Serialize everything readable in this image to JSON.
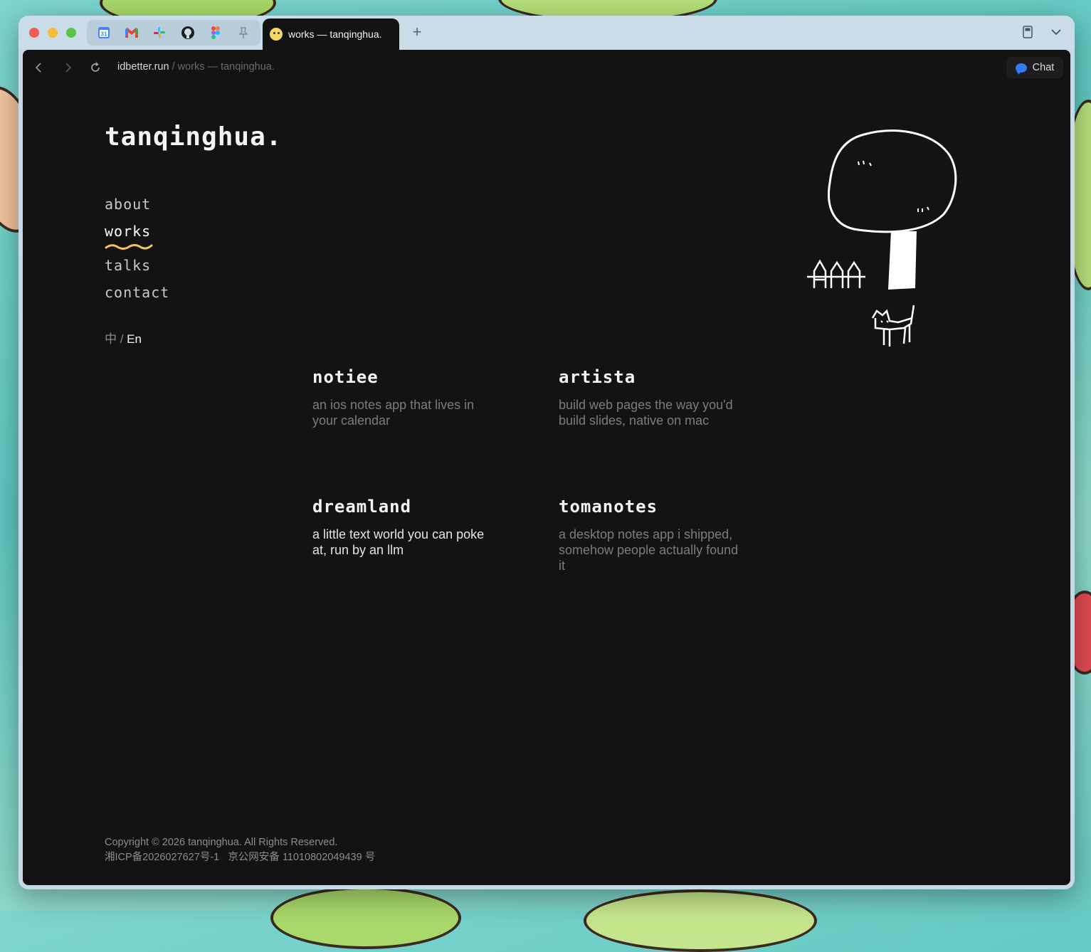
{
  "browser": {
    "pinned_tabs": [
      "calendar-icon",
      "gmail-icon",
      "slack-icon",
      "github-icon",
      "figma-icon",
      "pin-icon"
    ],
    "calendar_label": "31",
    "active_tab_title": "works — tanqinghua.",
    "url_domain": "idbetter.run",
    "url_separator": " / ",
    "url_path": "works — tanqinghua.",
    "chat_label": "Chat"
  },
  "site": {
    "logo": "tanqinghua.",
    "nav": [
      "about",
      "works",
      "talks",
      "contact"
    ],
    "active_nav": "works",
    "lang_zh": "中",
    "lang_sep": " / ",
    "lang_en": "En"
  },
  "works": [
    {
      "title": "notiee",
      "desc": "an ios notes app that lives in your calendar"
    },
    {
      "title": "artista",
      "desc": "build web pages the way you'd build slides, native on mac"
    },
    {
      "title": "dreamland",
      "desc": "a little text world you can poke at, run by an llm"
    },
    {
      "title": "tomanotes",
      "desc": "a desktop notes app i shipped, somehow people actually found it"
    }
  ],
  "footer": {
    "copyright": "Copyright © 2026 tanqinghua. All Rights Reserved.",
    "icp": "湘ICP备2026027627号-1",
    "police": "京公网安备 11010802049439 号"
  },
  "colors": {
    "accent_squiggle": "#f4c35a",
    "page_bg": "#131313",
    "chat_blue": "#2f7df6"
  }
}
